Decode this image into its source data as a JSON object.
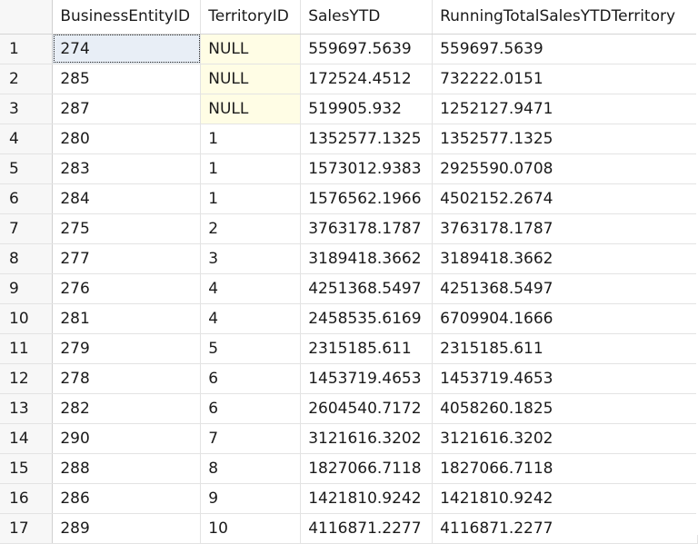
{
  "grid": {
    "columns": [
      "BusinessEntityID",
      "TerritoryID",
      "SalesYTD",
      "RunningTotalSalesYTDTerritory"
    ],
    "rows": [
      {
        "num": "1",
        "cells": [
          "274",
          "NULL",
          "559697.5639",
          "559697.5639"
        ]
      },
      {
        "num": "2",
        "cells": [
          "285",
          "NULL",
          "172524.4512",
          "732222.0151"
        ]
      },
      {
        "num": "3",
        "cells": [
          "287",
          "NULL",
          "519905.932",
          "1252127.9471"
        ]
      },
      {
        "num": "4",
        "cells": [
          "280",
          "1",
          "1352577.1325",
          "1352577.1325"
        ]
      },
      {
        "num": "5",
        "cells": [
          "283",
          "1",
          "1573012.9383",
          "2925590.0708"
        ]
      },
      {
        "num": "6",
        "cells": [
          "284",
          "1",
          "1576562.1966",
          "4502152.2674"
        ]
      },
      {
        "num": "7",
        "cells": [
          "275",
          "2",
          "3763178.1787",
          "3763178.1787"
        ]
      },
      {
        "num": "8",
        "cells": [
          "277",
          "3",
          "3189418.3662",
          "3189418.3662"
        ]
      },
      {
        "num": "9",
        "cells": [
          "276",
          "4",
          "4251368.5497",
          "4251368.5497"
        ]
      },
      {
        "num": "10",
        "cells": [
          "281",
          "4",
          "2458535.6169",
          "6709904.1666"
        ]
      },
      {
        "num": "11",
        "cells": [
          "279",
          "5",
          "2315185.611",
          "2315185.611"
        ]
      },
      {
        "num": "12",
        "cells": [
          "278",
          "6",
          "1453719.4653",
          "1453719.4653"
        ]
      },
      {
        "num": "13",
        "cells": [
          "282",
          "6",
          "2604540.7172",
          "4058260.1825"
        ]
      },
      {
        "num": "14",
        "cells": [
          "290",
          "7",
          "3121616.3202",
          "3121616.3202"
        ]
      },
      {
        "num": "15",
        "cells": [
          "288",
          "8",
          "1827066.7118",
          "1827066.7118"
        ]
      },
      {
        "num": "16",
        "cells": [
          "286",
          "9",
          "1421810.9242",
          "1421810.9242"
        ]
      },
      {
        "num": "17",
        "cells": [
          "289",
          "10",
          "4116871.2277",
          "4116871.2277"
        ]
      }
    ],
    "selected_cell": {
      "row": 1,
      "column": "BusinessEntityID"
    },
    "colors": {
      "null_highlight": "#fffde5",
      "selected_cell": "#e8eef6",
      "gridline": "#e3e3e3",
      "rownum_background": "#f7f7f7"
    }
  }
}
